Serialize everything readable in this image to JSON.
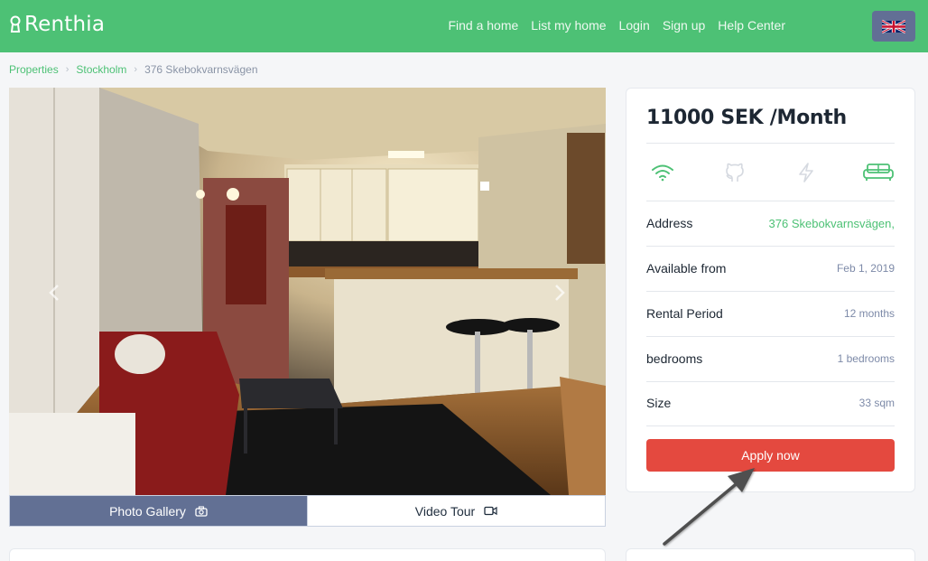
{
  "header": {
    "logo_text": "Renthia",
    "nav": [
      "Find a home",
      "List my home",
      "Login",
      "Sign up",
      "Help Center"
    ],
    "language_icon": "uk-flag-icon",
    "brand_color": "#4dc175"
  },
  "breadcrumb": {
    "items": [
      "Properties",
      "Stockholm"
    ],
    "current": "376 Skebokvarnsvägen"
  },
  "gallery": {
    "tabs": [
      {
        "label": "Photo Gallery",
        "icon": "camera-icon",
        "active": true
      },
      {
        "label": "Video Tour",
        "icon": "video-camera-icon",
        "active": false
      }
    ]
  },
  "listing": {
    "price": "11000 SEK /Month",
    "amenities": [
      {
        "icon": "wifi-icon",
        "active": true
      },
      {
        "icon": "github-icon",
        "active": false
      },
      {
        "icon": "lightning-icon",
        "active": false
      },
      {
        "icon": "sofa-icon",
        "active": true
      }
    ],
    "details": [
      {
        "label": "Address",
        "value": "376 Skebokvarnsvägen,"
      },
      {
        "label": "Available from",
        "value": "Feb 1, 2019"
      },
      {
        "label": "Rental Period",
        "value": "12 months"
      },
      {
        "label": "bedrooms",
        "value": "1 bedrooms"
      },
      {
        "label": "Size",
        "value": "33 sqm"
      }
    ],
    "apply_label": "Apply now",
    "apply_color": "#e4493f"
  }
}
